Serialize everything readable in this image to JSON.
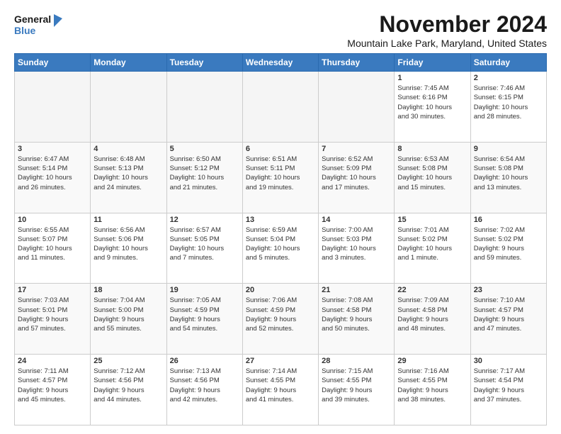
{
  "logo": {
    "line1": "General",
    "line2": "Blue"
  },
  "title": "November 2024",
  "location": "Mountain Lake Park, Maryland, United States",
  "weekdays": [
    "Sunday",
    "Monday",
    "Tuesday",
    "Wednesday",
    "Thursday",
    "Friday",
    "Saturday"
  ],
  "weeks": [
    [
      {
        "day": "",
        "info": ""
      },
      {
        "day": "",
        "info": ""
      },
      {
        "day": "",
        "info": ""
      },
      {
        "day": "",
        "info": ""
      },
      {
        "day": "",
        "info": ""
      },
      {
        "day": "1",
        "info": "Sunrise: 7:45 AM\nSunset: 6:16 PM\nDaylight: 10 hours\nand 30 minutes."
      },
      {
        "day": "2",
        "info": "Sunrise: 7:46 AM\nSunset: 6:15 PM\nDaylight: 10 hours\nand 28 minutes."
      }
    ],
    [
      {
        "day": "3",
        "info": "Sunrise: 6:47 AM\nSunset: 5:14 PM\nDaylight: 10 hours\nand 26 minutes."
      },
      {
        "day": "4",
        "info": "Sunrise: 6:48 AM\nSunset: 5:13 PM\nDaylight: 10 hours\nand 24 minutes."
      },
      {
        "day": "5",
        "info": "Sunrise: 6:50 AM\nSunset: 5:12 PM\nDaylight: 10 hours\nand 21 minutes."
      },
      {
        "day": "6",
        "info": "Sunrise: 6:51 AM\nSunset: 5:11 PM\nDaylight: 10 hours\nand 19 minutes."
      },
      {
        "day": "7",
        "info": "Sunrise: 6:52 AM\nSunset: 5:09 PM\nDaylight: 10 hours\nand 17 minutes."
      },
      {
        "day": "8",
        "info": "Sunrise: 6:53 AM\nSunset: 5:08 PM\nDaylight: 10 hours\nand 15 minutes."
      },
      {
        "day": "9",
        "info": "Sunrise: 6:54 AM\nSunset: 5:08 PM\nDaylight: 10 hours\nand 13 minutes."
      }
    ],
    [
      {
        "day": "10",
        "info": "Sunrise: 6:55 AM\nSunset: 5:07 PM\nDaylight: 10 hours\nand 11 minutes."
      },
      {
        "day": "11",
        "info": "Sunrise: 6:56 AM\nSunset: 5:06 PM\nDaylight: 10 hours\nand 9 minutes."
      },
      {
        "day": "12",
        "info": "Sunrise: 6:57 AM\nSunset: 5:05 PM\nDaylight: 10 hours\nand 7 minutes."
      },
      {
        "day": "13",
        "info": "Sunrise: 6:59 AM\nSunset: 5:04 PM\nDaylight: 10 hours\nand 5 minutes."
      },
      {
        "day": "14",
        "info": "Sunrise: 7:00 AM\nSunset: 5:03 PM\nDaylight: 10 hours\nand 3 minutes."
      },
      {
        "day": "15",
        "info": "Sunrise: 7:01 AM\nSunset: 5:02 PM\nDaylight: 10 hours\nand 1 minute."
      },
      {
        "day": "16",
        "info": "Sunrise: 7:02 AM\nSunset: 5:02 PM\nDaylight: 9 hours\nand 59 minutes."
      }
    ],
    [
      {
        "day": "17",
        "info": "Sunrise: 7:03 AM\nSunset: 5:01 PM\nDaylight: 9 hours\nand 57 minutes."
      },
      {
        "day": "18",
        "info": "Sunrise: 7:04 AM\nSunset: 5:00 PM\nDaylight: 9 hours\nand 55 minutes."
      },
      {
        "day": "19",
        "info": "Sunrise: 7:05 AM\nSunset: 4:59 PM\nDaylight: 9 hours\nand 54 minutes."
      },
      {
        "day": "20",
        "info": "Sunrise: 7:06 AM\nSunset: 4:59 PM\nDaylight: 9 hours\nand 52 minutes."
      },
      {
        "day": "21",
        "info": "Sunrise: 7:08 AM\nSunset: 4:58 PM\nDaylight: 9 hours\nand 50 minutes."
      },
      {
        "day": "22",
        "info": "Sunrise: 7:09 AM\nSunset: 4:58 PM\nDaylight: 9 hours\nand 48 minutes."
      },
      {
        "day": "23",
        "info": "Sunrise: 7:10 AM\nSunset: 4:57 PM\nDaylight: 9 hours\nand 47 minutes."
      }
    ],
    [
      {
        "day": "24",
        "info": "Sunrise: 7:11 AM\nSunset: 4:57 PM\nDaylight: 9 hours\nand 45 minutes."
      },
      {
        "day": "25",
        "info": "Sunrise: 7:12 AM\nSunset: 4:56 PM\nDaylight: 9 hours\nand 44 minutes."
      },
      {
        "day": "26",
        "info": "Sunrise: 7:13 AM\nSunset: 4:56 PM\nDaylight: 9 hours\nand 42 minutes."
      },
      {
        "day": "27",
        "info": "Sunrise: 7:14 AM\nSunset: 4:55 PM\nDaylight: 9 hours\nand 41 minutes."
      },
      {
        "day": "28",
        "info": "Sunrise: 7:15 AM\nSunset: 4:55 PM\nDaylight: 9 hours\nand 39 minutes."
      },
      {
        "day": "29",
        "info": "Sunrise: 7:16 AM\nSunset: 4:55 PM\nDaylight: 9 hours\nand 38 minutes."
      },
      {
        "day": "30",
        "info": "Sunrise: 7:17 AM\nSunset: 4:54 PM\nDaylight: 9 hours\nand 37 minutes."
      }
    ]
  ]
}
